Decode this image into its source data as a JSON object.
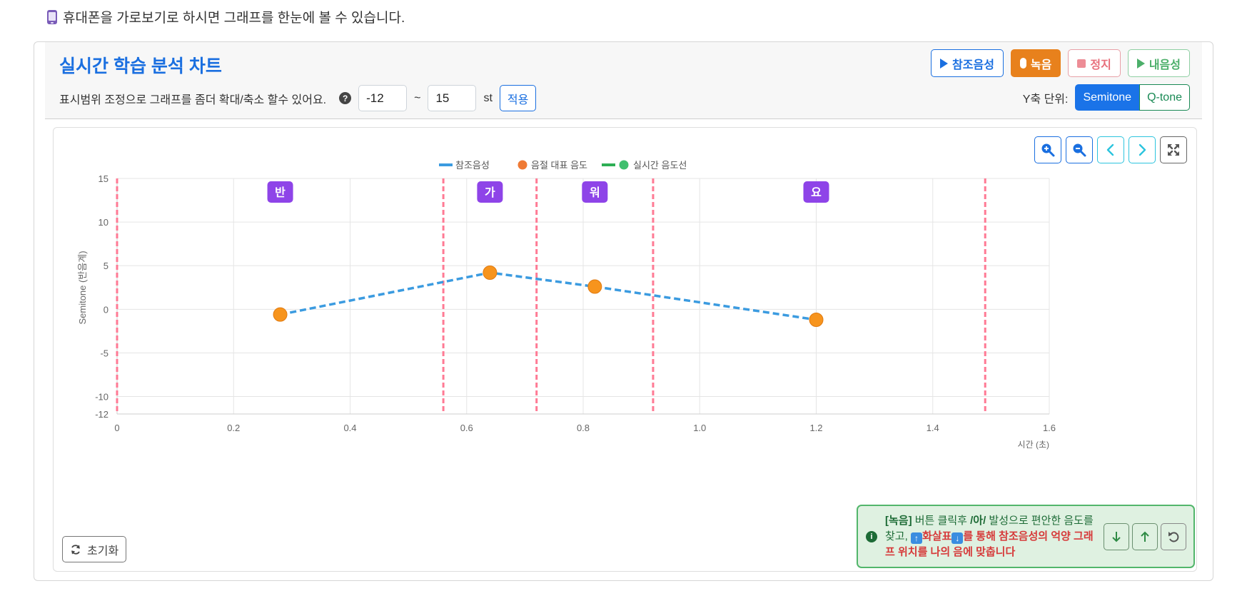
{
  "notice": "휴대폰을 가로보기로 하시면 그래프를 한눈에 볼 수 있습니다.",
  "header": {
    "title": "실시간 학습 분석 차트",
    "range_label": "표시범위 조정으로 그래프를 좀더 확대/축소 할수 있어요.",
    "range_min": "-12",
    "range_sep": "~",
    "range_max": "15",
    "range_unit": "st",
    "apply_label": "적용",
    "buttons": {
      "reference": "참조음성",
      "record": "녹음",
      "stop": "정지",
      "mine": "내음성"
    },
    "yunit_label": "Y축 단위:",
    "yunit_options": [
      "Semitone",
      "Q-tone"
    ],
    "yunit_selected": "Semitone"
  },
  "colors": {
    "accent": "#1a6fe0",
    "record": "#e8811c",
    "reference_line": "#3b9be0",
    "syllable_point": "#f7941d",
    "boundary": "#ff7a94",
    "syllable_badge": "#8e44e8",
    "realtime": "#2eaf55"
  },
  "chart_data": {
    "type": "line",
    "legend_position": "top",
    "legend": [
      "참조음성",
      "음절 대표 음도",
      "실시간 음도선"
    ],
    "xlabel": "시간 (초)",
    "ylabel": "Semitone (반음계)",
    "xlim": [
      0,
      1.6
    ],
    "ylim": [
      -12,
      15
    ],
    "x_ticks": [
      "0",
      "0.2",
      "0.4",
      "0.6",
      "0.8",
      "1.0",
      "1.2",
      "1.4",
      "1.6"
    ],
    "x_tick_values": [
      0,
      0.2,
      0.4,
      0.6,
      0.8,
      1.0,
      1.2,
      1.4,
      1.6
    ],
    "y_ticks": [
      "15",
      "10",
      "5",
      "0",
      "-5",
      "-10",
      "-12"
    ],
    "y_tick_values": [
      15,
      10,
      5,
      0,
      -5,
      -10,
      -12
    ],
    "grid": true,
    "series": [
      {
        "name": "참조음성",
        "style": "dashed",
        "x": [
          0.28,
          0.64,
          0.82,
          1.2
        ],
        "y": [
          -0.6,
          4.2,
          2.6,
          -1.2
        ]
      }
    ],
    "syllable_points": [
      {
        "x": 0.28,
        "y": -0.6
      },
      {
        "x": 0.64,
        "y": 4.2
      },
      {
        "x": 0.82,
        "y": 2.6
      },
      {
        "x": 1.2,
        "y": -1.2
      }
    ],
    "boundaries": [
      0,
      0.56,
      0.72,
      0.92,
      1.49
    ],
    "syllables": [
      {
        "text": "반",
        "x": 0.28
      },
      {
        "text": "가",
        "x": 0.64
      },
      {
        "text": "워",
        "x": 0.82
      },
      {
        "text": "요",
        "x": 1.2
      }
    ]
  },
  "reset_label": "초기화",
  "hint": {
    "part1": "[녹음]",
    "part2": " 버튼 클릭후 ",
    "part3": "/아/",
    "part4": " 발성으로 편안한 음도를 찾고, ",
    "part5": "화살표",
    "part6": "를 통해 참조음성의 억양 그래프 위치를 나의 음에 맞춥니다"
  }
}
